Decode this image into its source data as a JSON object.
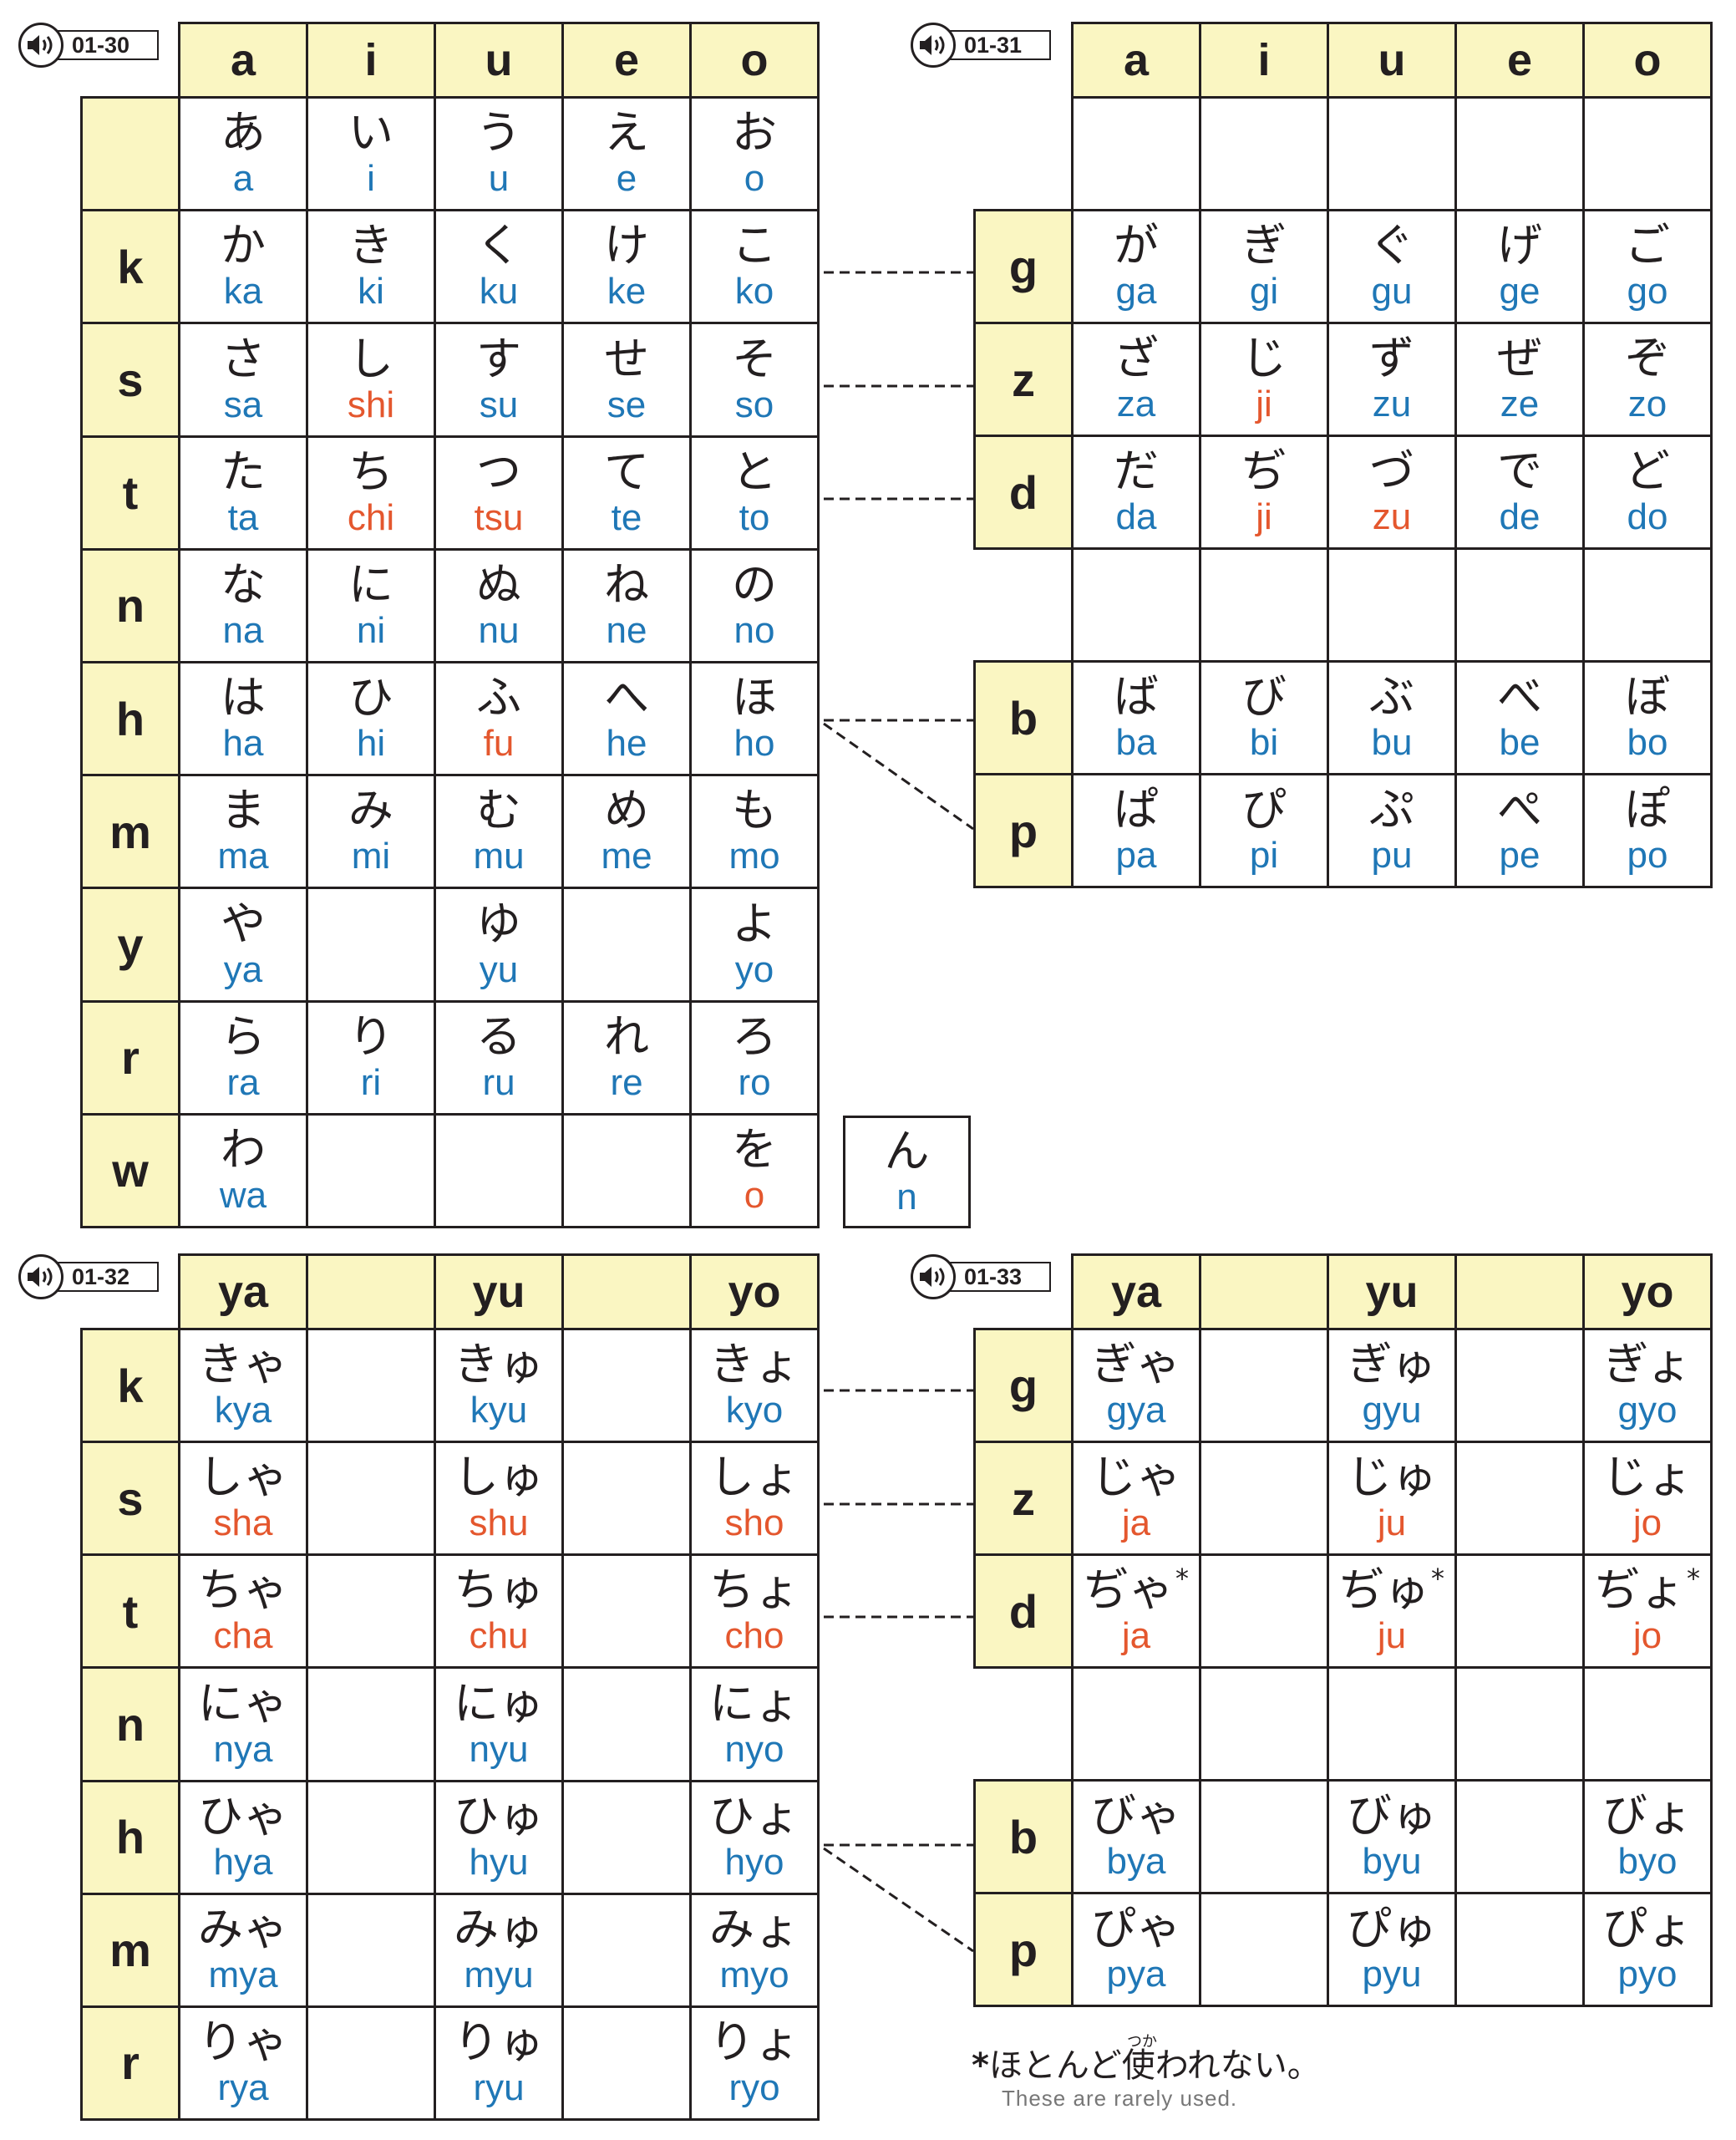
{
  "colors": {
    "header_bg": "#faf6c2",
    "romaji_regular": "#1f77b6",
    "romaji_irregular": "#e4572e",
    "border": "#231f20"
  },
  "icon": "speaker-icon",
  "t1": {
    "audio_code": "01-30",
    "headers": [
      "a",
      "i",
      "u",
      "e",
      "o"
    ],
    "rows": [
      {
        "label": "",
        "cells": [
          {
            "k": "あ",
            "r": "a"
          },
          {
            "k": "い",
            "r": "i"
          },
          {
            "k": "う",
            "r": "u"
          },
          {
            "k": "え",
            "r": "e"
          },
          {
            "k": "お",
            "r": "o"
          }
        ]
      },
      {
        "label": "k",
        "cells": [
          {
            "k": "か",
            "r": "ka"
          },
          {
            "k": "き",
            "r": "ki"
          },
          {
            "k": "く",
            "r": "ku"
          },
          {
            "k": "け",
            "r": "ke"
          },
          {
            "k": "こ",
            "r": "ko"
          }
        ]
      },
      {
        "label": "s",
        "cells": [
          {
            "k": "さ",
            "r": "sa"
          },
          {
            "k": "し",
            "r": "shi",
            "x": 1
          },
          {
            "k": "す",
            "r": "su"
          },
          {
            "k": "せ",
            "r": "se"
          },
          {
            "k": "そ",
            "r": "so"
          }
        ]
      },
      {
        "label": "t",
        "cells": [
          {
            "k": "た",
            "r": "ta"
          },
          {
            "k": "ち",
            "r": "chi",
            "x": 1
          },
          {
            "k": "つ",
            "r": "tsu",
            "x": 1
          },
          {
            "k": "て",
            "r": "te"
          },
          {
            "k": "と",
            "r": "to"
          }
        ]
      },
      {
        "label": "n",
        "cells": [
          {
            "k": "な",
            "r": "na"
          },
          {
            "k": "に",
            "r": "ni"
          },
          {
            "k": "ぬ",
            "r": "nu"
          },
          {
            "k": "ね",
            "r": "ne"
          },
          {
            "k": "の",
            "r": "no"
          }
        ]
      },
      {
        "label": "h",
        "cells": [
          {
            "k": "は",
            "r": "ha"
          },
          {
            "k": "ひ",
            "r": "hi"
          },
          {
            "k": "ふ",
            "r": "fu",
            "x": 1
          },
          {
            "k": "へ",
            "r": "he"
          },
          {
            "k": "ほ",
            "r": "ho"
          }
        ]
      },
      {
        "label": "m",
        "cells": [
          {
            "k": "ま",
            "r": "ma"
          },
          {
            "k": "み",
            "r": "mi"
          },
          {
            "k": "む",
            "r": "mu"
          },
          {
            "k": "め",
            "r": "me"
          },
          {
            "k": "も",
            "r": "mo"
          }
        ]
      },
      {
        "label": "y",
        "cells": [
          {
            "k": "や",
            "r": "ya"
          },
          {},
          {
            "k": "ゆ",
            "r": "yu"
          },
          {},
          {
            "k": "よ",
            "r": "yo"
          }
        ]
      },
      {
        "label": "r",
        "cells": [
          {
            "k": "ら",
            "r": "ra"
          },
          {
            "k": "り",
            "r": "ri"
          },
          {
            "k": "る",
            "r": "ru"
          },
          {
            "k": "れ",
            "r": "re"
          },
          {
            "k": "ろ",
            "r": "ro"
          }
        ]
      },
      {
        "label": "w",
        "cells": [
          {
            "k": "わ",
            "r": "wa"
          },
          {},
          {},
          {},
          {
            "k": "を",
            "r": "o",
            "x": 1
          }
        ]
      }
    ]
  },
  "n_box": {
    "k": "ん",
    "r": "n"
  },
  "t2": {
    "audio_code": "01-31",
    "headers": [
      "a",
      "i",
      "u",
      "e",
      "o"
    ],
    "rows": [
      {
        "label": "g",
        "cells": [
          {
            "k": "が",
            "r": "ga"
          },
          {
            "k": "ぎ",
            "r": "gi"
          },
          {
            "k": "ぐ",
            "r": "gu"
          },
          {
            "k": "げ",
            "r": "ge"
          },
          {
            "k": "ご",
            "r": "go"
          }
        ]
      },
      {
        "label": "z",
        "cells": [
          {
            "k": "ざ",
            "r": "za"
          },
          {
            "k": "じ",
            "r": "ji",
            "x": 1
          },
          {
            "k": "ず",
            "r": "zu"
          },
          {
            "k": "ぜ",
            "r": "ze"
          },
          {
            "k": "ぞ",
            "r": "zo"
          }
        ]
      },
      {
        "label": "d",
        "cells": [
          {
            "k": "だ",
            "r": "da"
          },
          {
            "k": "ぢ",
            "r": "ji",
            "x": 1
          },
          {
            "k": "づ",
            "r": "zu",
            "x": 1
          },
          {
            "k": "で",
            "r": "de"
          },
          {
            "k": "ど",
            "r": "do"
          }
        ]
      },
      {
        "label": "b",
        "cells": [
          {
            "k": "ば",
            "r": "ba"
          },
          {
            "k": "び",
            "r": "bi"
          },
          {
            "k": "ぶ",
            "r": "bu"
          },
          {
            "k": "べ",
            "r": "be"
          },
          {
            "k": "ぼ",
            "r": "bo"
          }
        ]
      },
      {
        "label": "p",
        "cells": [
          {
            "k": "ぱ",
            "r": "pa"
          },
          {
            "k": "ぴ",
            "r": "pi"
          },
          {
            "k": "ぷ",
            "r": "pu"
          },
          {
            "k": "ぺ",
            "r": "pe"
          },
          {
            "k": "ぽ",
            "r": "po"
          }
        ]
      }
    ]
  },
  "t3": {
    "audio_code": "01-32",
    "headers": [
      "ya",
      "",
      "yu",
      "",
      "yo"
    ],
    "rows": [
      {
        "label": "k",
        "cells": [
          {
            "k": "きゃ",
            "r": "kya"
          },
          {},
          {
            "k": "きゅ",
            "r": "kyu"
          },
          {},
          {
            "k": "きょ",
            "r": "kyo"
          }
        ]
      },
      {
        "label": "s",
        "cells": [
          {
            "k": "しゃ",
            "r": "sha",
            "x": 1
          },
          {},
          {
            "k": "しゅ",
            "r": "shu",
            "x": 1
          },
          {},
          {
            "k": "しょ",
            "r": "sho",
            "x": 1
          }
        ]
      },
      {
        "label": "t",
        "cells": [
          {
            "k": "ちゃ",
            "r": "cha",
            "x": 1
          },
          {},
          {
            "k": "ちゅ",
            "r": "chu",
            "x": 1
          },
          {},
          {
            "k": "ちょ",
            "r": "cho",
            "x": 1
          }
        ]
      },
      {
        "label": "n",
        "cells": [
          {
            "k": "にゃ",
            "r": "nya"
          },
          {},
          {
            "k": "にゅ",
            "r": "nyu"
          },
          {},
          {
            "k": "にょ",
            "r": "nyo"
          }
        ]
      },
      {
        "label": "h",
        "cells": [
          {
            "k": "ひゃ",
            "r": "hya"
          },
          {},
          {
            "k": "ひゅ",
            "r": "hyu"
          },
          {},
          {
            "k": "ひょ",
            "r": "hyo"
          }
        ]
      },
      {
        "label": "m",
        "cells": [
          {
            "k": "みゃ",
            "r": "mya"
          },
          {},
          {
            "k": "みゅ",
            "r": "myu"
          },
          {},
          {
            "k": "みょ",
            "r": "myo"
          }
        ]
      },
      {
        "label": "r",
        "cells": [
          {
            "k": "りゃ",
            "r": "rya"
          },
          {},
          {
            "k": "りゅ",
            "r": "ryu"
          },
          {},
          {
            "k": "りょ",
            "r": "ryo"
          }
        ]
      }
    ]
  },
  "t4": {
    "audio_code": "01-33",
    "headers": [
      "ya",
      "",
      "yu",
      "",
      "yo"
    ],
    "rows": [
      {
        "label": "g",
        "cells": [
          {
            "k": "ぎゃ",
            "r": "gya"
          },
          {},
          {
            "k": "ぎゅ",
            "r": "gyu"
          },
          {},
          {
            "k": "ぎょ",
            "r": "gyo"
          }
        ]
      },
      {
        "label": "z",
        "cells": [
          {
            "k": "じゃ",
            "r": "ja",
            "x": 1
          },
          {},
          {
            "k": "じゅ",
            "r": "ju",
            "x": 1
          },
          {},
          {
            "k": "じょ",
            "r": "jo",
            "x": 1
          }
        ]
      },
      {
        "label": "d",
        "cells": [
          {
            "k": "ぢゃ",
            "r": "ja",
            "x": 1,
            "s": "*"
          },
          {},
          {
            "k": "ぢゅ",
            "r": "ju",
            "x": 1,
            "s": "*"
          },
          {},
          {
            "k": "ぢょ",
            "r": "jo",
            "x": 1,
            "s": "*"
          }
        ]
      },
      {
        "label": "b",
        "cells": [
          {
            "k": "びゃ",
            "r": "bya"
          },
          {},
          {
            "k": "びゅ",
            "r": "byu"
          },
          {},
          {
            "k": "びょ",
            "r": "byo"
          }
        ]
      },
      {
        "label": "p",
        "cells": [
          {
            "k": "ぴゃ",
            "r": "pya"
          },
          {},
          {
            "k": "ぴゅ",
            "r": "pyu"
          },
          {},
          {
            "k": "ぴょ",
            "r": "pyo"
          }
        ]
      }
    ]
  },
  "note": {
    "star": "*",
    "jp": "ほとんど使われない。",
    "ruby": "つか",
    "en": "These are rarely used."
  }
}
